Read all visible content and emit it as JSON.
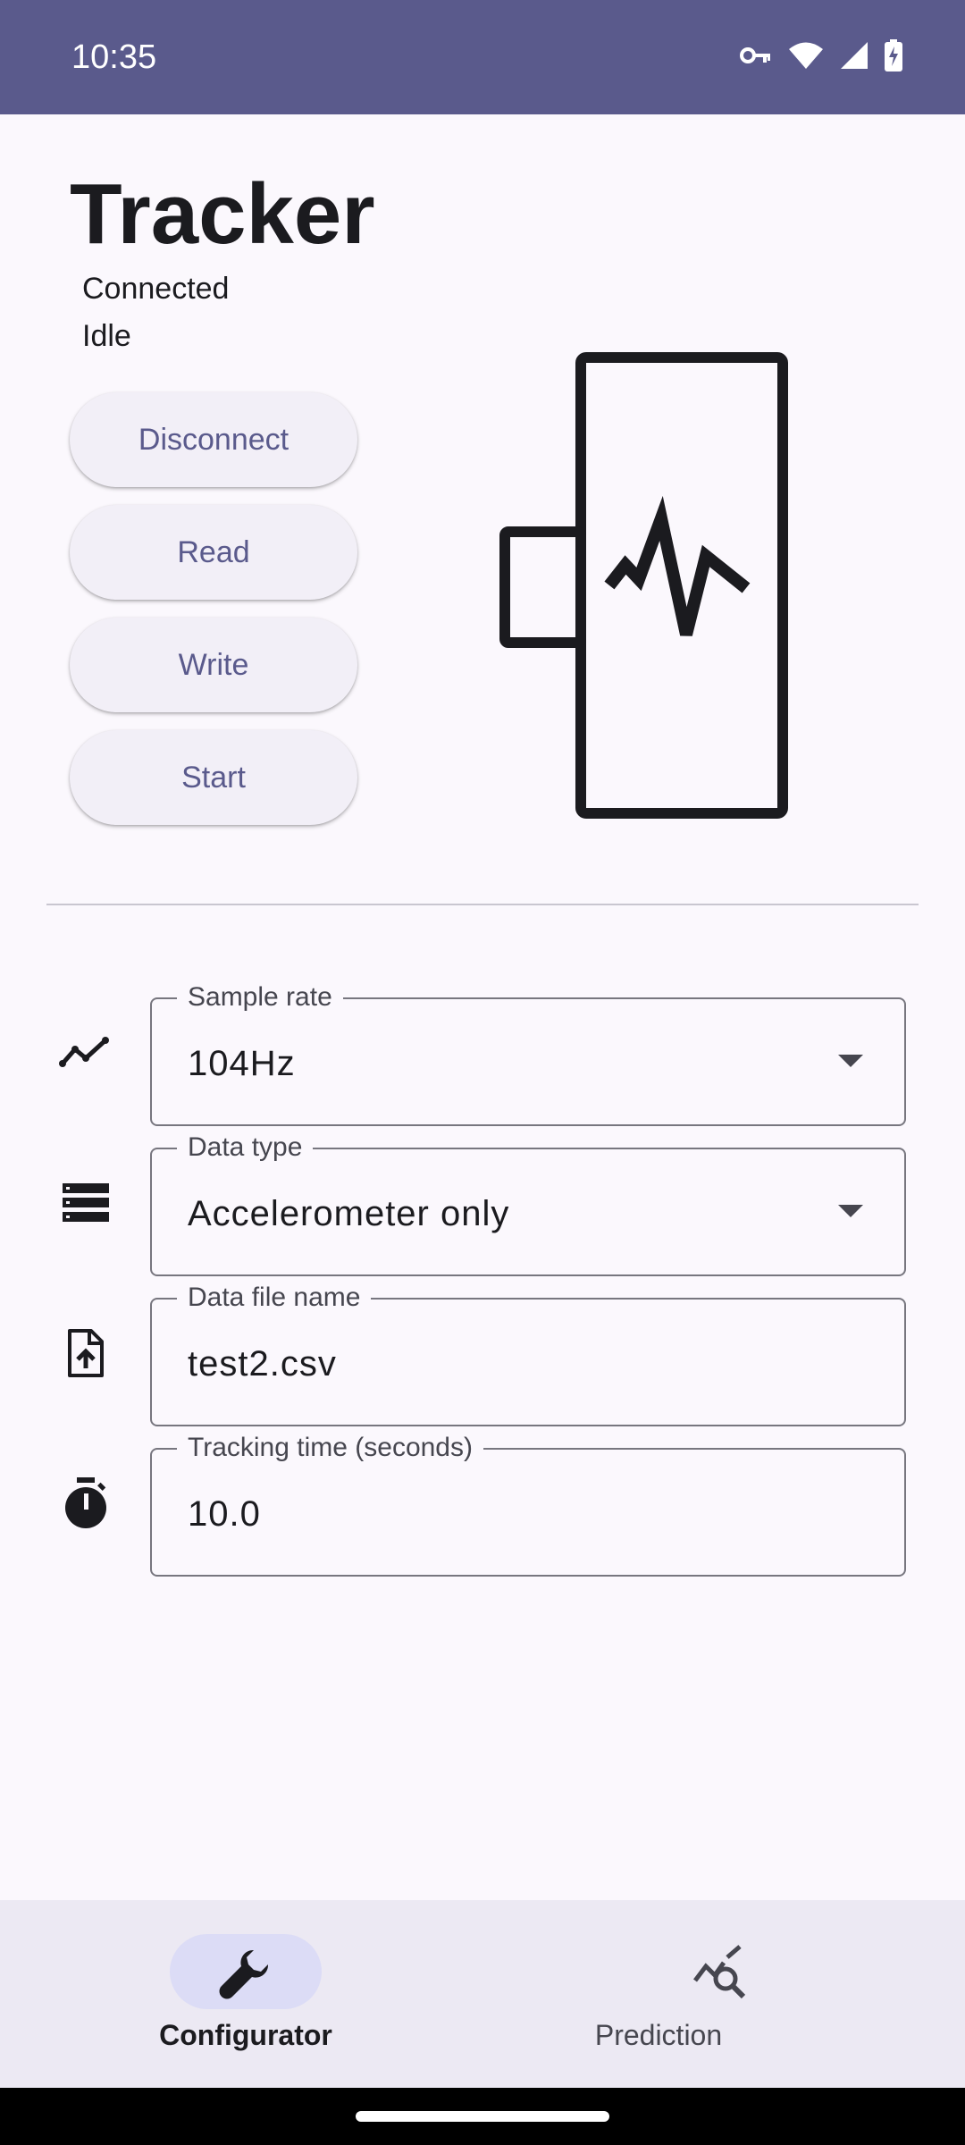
{
  "status_bar": {
    "time": "10:35",
    "icons": [
      "vpn-key-icon",
      "wifi-icon",
      "cellular-signal-icon",
      "battery-charging-icon"
    ]
  },
  "header": {
    "title": "Tracker",
    "connection_status": "Connected",
    "activity_status": "Idle"
  },
  "actions": {
    "disconnect": "Disconnect",
    "read": "Read",
    "write": "Write",
    "start": "Start"
  },
  "form": {
    "sample_rate": {
      "label": "Sample rate",
      "value": "104Hz",
      "icon": "trend-line-icon"
    },
    "data_type": {
      "label": "Data type",
      "value": "Accelerometer only",
      "icon": "storage-list-icon"
    },
    "file_name": {
      "label": "Data file name",
      "value": "test2.csv",
      "icon": "file-upload-icon"
    },
    "tracking_time": {
      "label": "Tracking time (seconds)",
      "value": "10.0",
      "icon": "timer-icon"
    }
  },
  "bottom_nav": {
    "configurator": {
      "label": "Configurator",
      "icon": "wrench-icon",
      "selected": true
    },
    "prediction": {
      "label": "Prediction",
      "icon": "query-stats-icon",
      "selected": false
    }
  },
  "colors": {
    "primary": "#5a5a8c",
    "background": "#fbf8fd",
    "nav_background": "#ece9f3",
    "nav_indicator": "#dcdcf6"
  }
}
